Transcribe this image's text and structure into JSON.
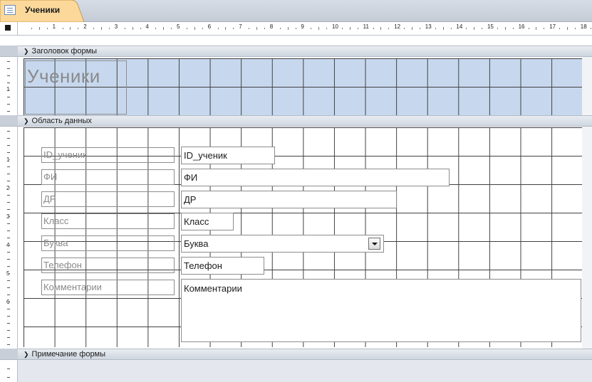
{
  "tab": {
    "title": "Ученики"
  },
  "ruler": {
    "numbers": [
      "1",
      "2",
      "3",
      "4",
      "5",
      "6",
      "7",
      "8",
      "9",
      "10",
      "11",
      "12",
      "13",
      "14",
      "15",
      "16",
      "17",
      "18"
    ]
  },
  "vruler_header": [
    "1"
  ],
  "vruler_detail": [
    "1",
    "2",
    "3",
    "4",
    "5",
    "6"
  ],
  "sections": {
    "header": "Заголовок формы",
    "detail": "Область данных",
    "footer": "Примечание формы"
  },
  "form_title": "Ученики",
  "fields": [
    {
      "label": "ID_ученик",
      "control": "ID_ученик"
    },
    {
      "label": "ФИ",
      "control": "ФИ"
    },
    {
      "label": "ДР",
      "control": "ДР"
    },
    {
      "label": "Класс",
      "control": "Класс"
    },
    {
      "label": "Буква",
      "control": "Буква"
    },
    {
      "label": "Телефон",
      "control": "Телефон"
    },
    {
      "label": "Комментарии",
      "control": "Комментарии"
    }
  ],
  "icons": {
    "tab": "form-icon",
    "section": "section-arrow-icon",
    "dropdown": "dropdown-arrow-icon"
  },
  "colors": {
    "header_bg": "#c7d8ee",
    "grid": "#404040",
    "tab_bg": "#fbd593"
  }
}
